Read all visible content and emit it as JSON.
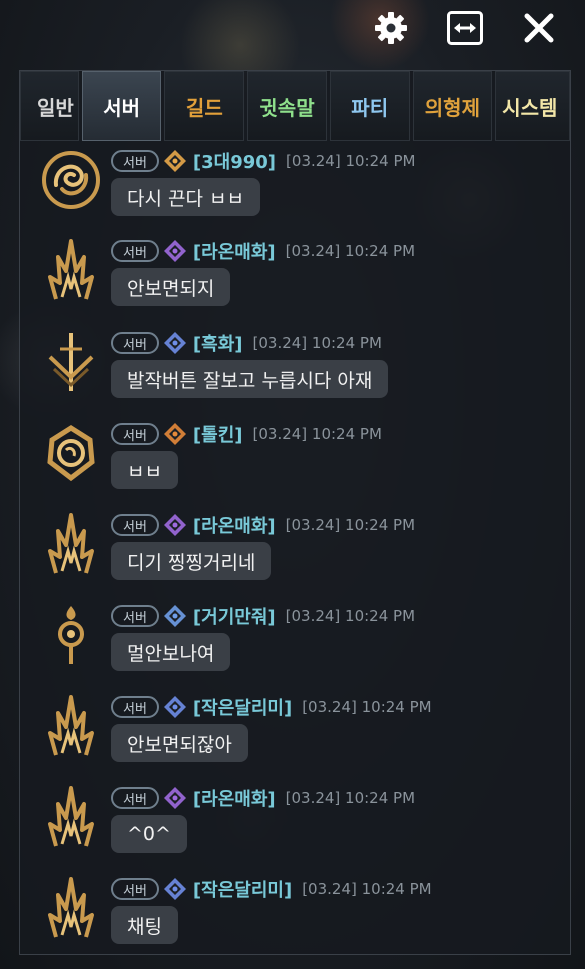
{
  "window": {
    "icons": {
      "settings": "gear-icon",
      "resize": "expand-horizontal-icon",
      "close": "close-icon"
    }
  },
  "tabs": [
    {
      "label": "일반",
      "color": "#d8d8d8"
    },
    {
      "label": "서버",
      "color": "#ffffff",
      "active": true
    },
    {
      "label": "길드",
      "color": "#e2a03a"
    },
    {
      "label": "귓속말",
      "color": "#8fe08c"
    },
    {
      "label": "파티",
      "color": "#8fc8f0"
    },
    {
      "label": "의형제",
      "color": "#e0a23c"
    },
    {
      "label": "시스템",
      "color": "#f2e6a8"
    }
  ],
  "messages": [
    {
      "badge": "서버",
      "name": "[3대990]",
      "time": "[03.24] 10:24 PM",
      "text": "다시 끈다 ㅂㅂ",
      "avatar": "swirl-emblem-icon",
      "class_color": "#e8a94a"
    },
    {
      "badge": "서버",
      "name": "[라온매화]",
      "time": "[03.24] 10:24 PM",
      "text": "안보면되지",
      "avatar": "claw-emblem-icon",
      "class_color": "#9f6be0"
    },
    {
      "badge": "서버",
      "name": "[흑화]",
      "time": "[03.24] 10:24 PM",
      "text": "발작버튼 잘보고 누릅시다 아재",
      "avatar": "sword-emblem-icon",
      "class_color": "#6f8ee8"
    },
    {
      "badge": "서버",
      "name": "[톨킨]",
      "time": "[03.24] 10:24 PM",
      "text": "ㅂㅂ",
      "avatar": "rose-emblem-icon",
      "class_color": "#e58a3a"
    },
    {
      "badge": "서버",
      "name": "[라온매화]",
      "time": "[03.24] 10:24 PM",
      "text": "디기 찡찡거리네",
      "avatar": "claw-emblem-icon",
      "class_color": "#9f6be0"
    },
    {
      "badge": "서버",
      "name": "[거기만줘]",
      "time": "[03.24] 10:24 PM",
      "text": "멀안보나여",
      "avatar": "staff-emblem-icon",
      "class_color": "#6f9ee8"
    },
    {
      "badge": "서버",
      "name": "[작은달리미]",
      "time": "[03.24] 10:24 PM",
      "text": "안보면되잖아",
      "avatar": "claw-emblem-icon",
      "class_color": "#6f8ee8"
    },
    {
      "badge": "서버",
      "name": "[라온매화]",
      "time": "[03.24] 10:24 PM",
      "text": "^0^",
      "avatar": "claw-emblem-icon",
      "class_color": "#9f6be0"
    },
    {
      "badge": "서버",
      "name": "[작은달리미]",
      "time": "[03.24] 10:24 PM",
      "text": "채팅",
      "avatar": "claw-emblem-icon",
      "class_color": "#6f8ee8"
    }
  ]
}
